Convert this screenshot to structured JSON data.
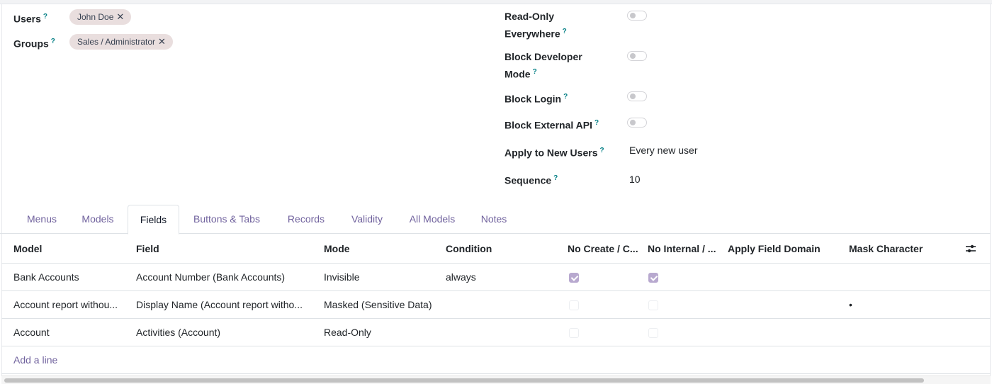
{
  "left_fields": {
    "users": {
      "label": "Users",
      "help": "?",
      "tags": [
        "John Doe"
      ]
    },
    "groups": {
      "label": "Groups",
      "help": "?",
      "tags": [
        "Sales / Administrator"
      ]
    },
    "remove_glyph": "✕"
  },
  "right_fields": {
    "read_only": {
      "label_line1": "Read-Only",
      "label_line2": "Everywhere",
      "help": "?",
      "value": false
    },
    "block_dev": {
      "label_line1": "Block Developer",
      "label_line2": "Mode",
      "help": "?",
      "value": false
    },
    "block_login": {
      "label": "Block Login",
      "help": "?",
      "value": false
    },
    "block_api": {
      "label": "Block External API",
      "help": "?",
      "value": false
    },
    "apply_new": {
      "label": "Apply to New Users",
      "help": "?",
      "value": "Every new user"
    },
    "sequence": {
      "label": "Sequence",
      "help": "?",
      "value": "10"
    }
  },
  "tabs": [
    "Menus",
    "Models",
    "Fields",
    "Buttons & Tabs",
    "Records",
    "Validity",
    "All Models",
    "Notes"
  ],
  "active_tab": "Fields",
  "table": {
    "columns": [
      "Model",
      "Field",
      "Mode",
      "Condition",
      "No Create / C...",
      "No Internal / ...",
      "Apply Field Domain",
      "Mask Character"
    ],
    "rows": [
      {
        "model": "Bank Accounts",
        "field": "Account Number (Bank Accounts)",
        "mode": "Invisible",
        "condition": "always",
        "no_create": true,
        "no_internal": true,
        "apply_domain": "",
        "mask": ""
      },
      {
        "model": "Account report withou...",
        "field": "Display Name (Account report witho...",
        "mode": "Masked (Sensitive Data)",
        "condition": "",
        "no_create": false,
        "no_internal": false,
        "apply_domain": "",
        "mask": "•"
      },
      {
        "model": "Account",
        "field": "Activities (Account)",
        "mode": "Read-Only",
        "condition": "",
        "no_create": false,
        "no_internal": false,
        "apply_domain": "",
        "mask": ""
      }
    ],
    "add_line": "Add a line",
    "settings_icon": "sliders-icon"
  },
  "colors": {
    "accent": "#71639e",
    "help": "#017e84",
    "tag_bg": "#e9dede",
    "checkbox_on": "#b8a9cf"
  }
}
